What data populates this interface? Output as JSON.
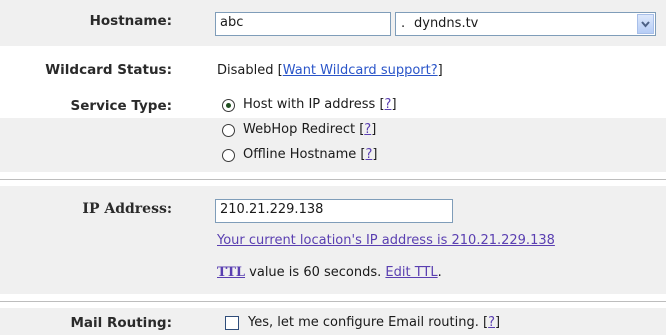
{
  "hostname": {
    "label": "Hostname:",
    "value": "abc",
    "dot": ".",
    "domain": "dyndns.tv"
  },
  "wildcard": {
    "label": "Wildcard Status:",
    "status": "Disabled",
    "open_bracket": "[",
    "link": "Want Wildcard support?",
    "close_bracket": "]"
  },
  "service": {
    "label": "Service Type:",
    "options": [
      {
        "label": "Host with IP address",
        "help": "?",
        "selected": true
      },
      {
        "label": "WebHop Redirect",
        "help": "?",
        "selected": false
      },
      {
        "label": "Offline Hostname",
        "help": "?",
        "selected": false
      }
    ],
    "open_bracket": "[",
    "close_bracket": "]"
  },
  "ip": {
    "label": "IP Address:",
    "value": "210.21.229.138",
    "current_link": "Your current location's IP address is 210.21.229.138",
    "ttl_link": "TTL",
    "ttl_text": " value is 60 seconds. ",
    "edit_ttl": "Edit TTL",
    "period": "."
  },
  "mail": {
    "label": "Mail Routing:",
    "checkbox_label": "Yes, let me configure Email routing.",
    "help": "?",
    "open_bracket": "[",
    "close_bracket": "]"
  },
  "colors": {
    "band_gray": "#f0f0f0",
    "link_visited": "#5a3fb1",
    "link_blue": "#2a55c9"
  }
}
